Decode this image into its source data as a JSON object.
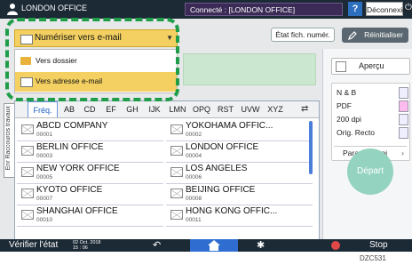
{
  "header": {
    "user": "LONDON OFFICE",
    "connection": "Connecté : [LONDON OFFICE]",
    "help": "?",
    "logout": "Déconnexion"
  },
  "toolbar": {
    "file_status": "État fich. numér.",
    "reset": "Réinitialiser"
  },
  "dropdown": {
    "selected": "Numériser vers e-mail",
    "options": [
      {
        "label": "Vers dossier",
        "icon": "folder-icon"
      },
      {
        "label": "Vers adresse e-mail",
        "icon": "envelope-icon",
        "selected": true
      }
    ]
  },
  "side_tab": "Enr Raccourcis travaux",
  "address_book": {
    "tabs": [
      "Fréq.",
      "AB",
      "CD",
      "EF",
      "GH",
      "IJK",
      "LMN",
      "OPQ",
      "RST",
      "UVW",
      "XYZ"
    ],
    "active_tab": "Fréq.",
    "entries": [
      {
        "name": "ABCD COMPANY",
        "num": "00001"
      },
      {
        "name": "YOKOHAMA OFFIC...",
        "num": "00002"
      },
      {
        "name": "BERLIN OFFICE",
        "num": "00003"
      },
      {
        "name": "LONDON OFFICE",
        "num": "00004"
      },
      {
        "name": "NEW YORK OFFICE",
        "num": "00005"
      },
      {
        "name": "LOS ANGELES",
        "num": "00006"
      },
      {
        "name": "KYOTO OFFICE",
        "num": "00007"
      },
      {
        "name": "BEIJING OFFICE",
        "num": "00008"
      },
      {
        "name": "SHANGHAI  OFFICE",
        "num": "00010"
      },
      {
        "name": "HONG KONG OFFIC...",
        "num": "00011"
      }
    ]
  },
  "settings": {
    "preview": "Aperçu",
    "color": "N & B",
    "format": "PDF",
    "resolution": "200 dpi",
    "original": "Orig. Recto",
    "send_params": "Param. envoi"
  },
  "start": "Départ",
  "bottom": {
    "verify": "Vérifier l'état",
    "date": "02 Oct. 2018",
    "time": "15 : 06",
    "stop": "Stop"
  },
  "caption": "DZC531",
  "colors": {
    "topbar": "#1c2a36",
    "highlight": "#f3d061",
    "outline": "#1f9d48",
    "start": "#93d3c0",
    "home": "#2f6ed0"
  }
}
